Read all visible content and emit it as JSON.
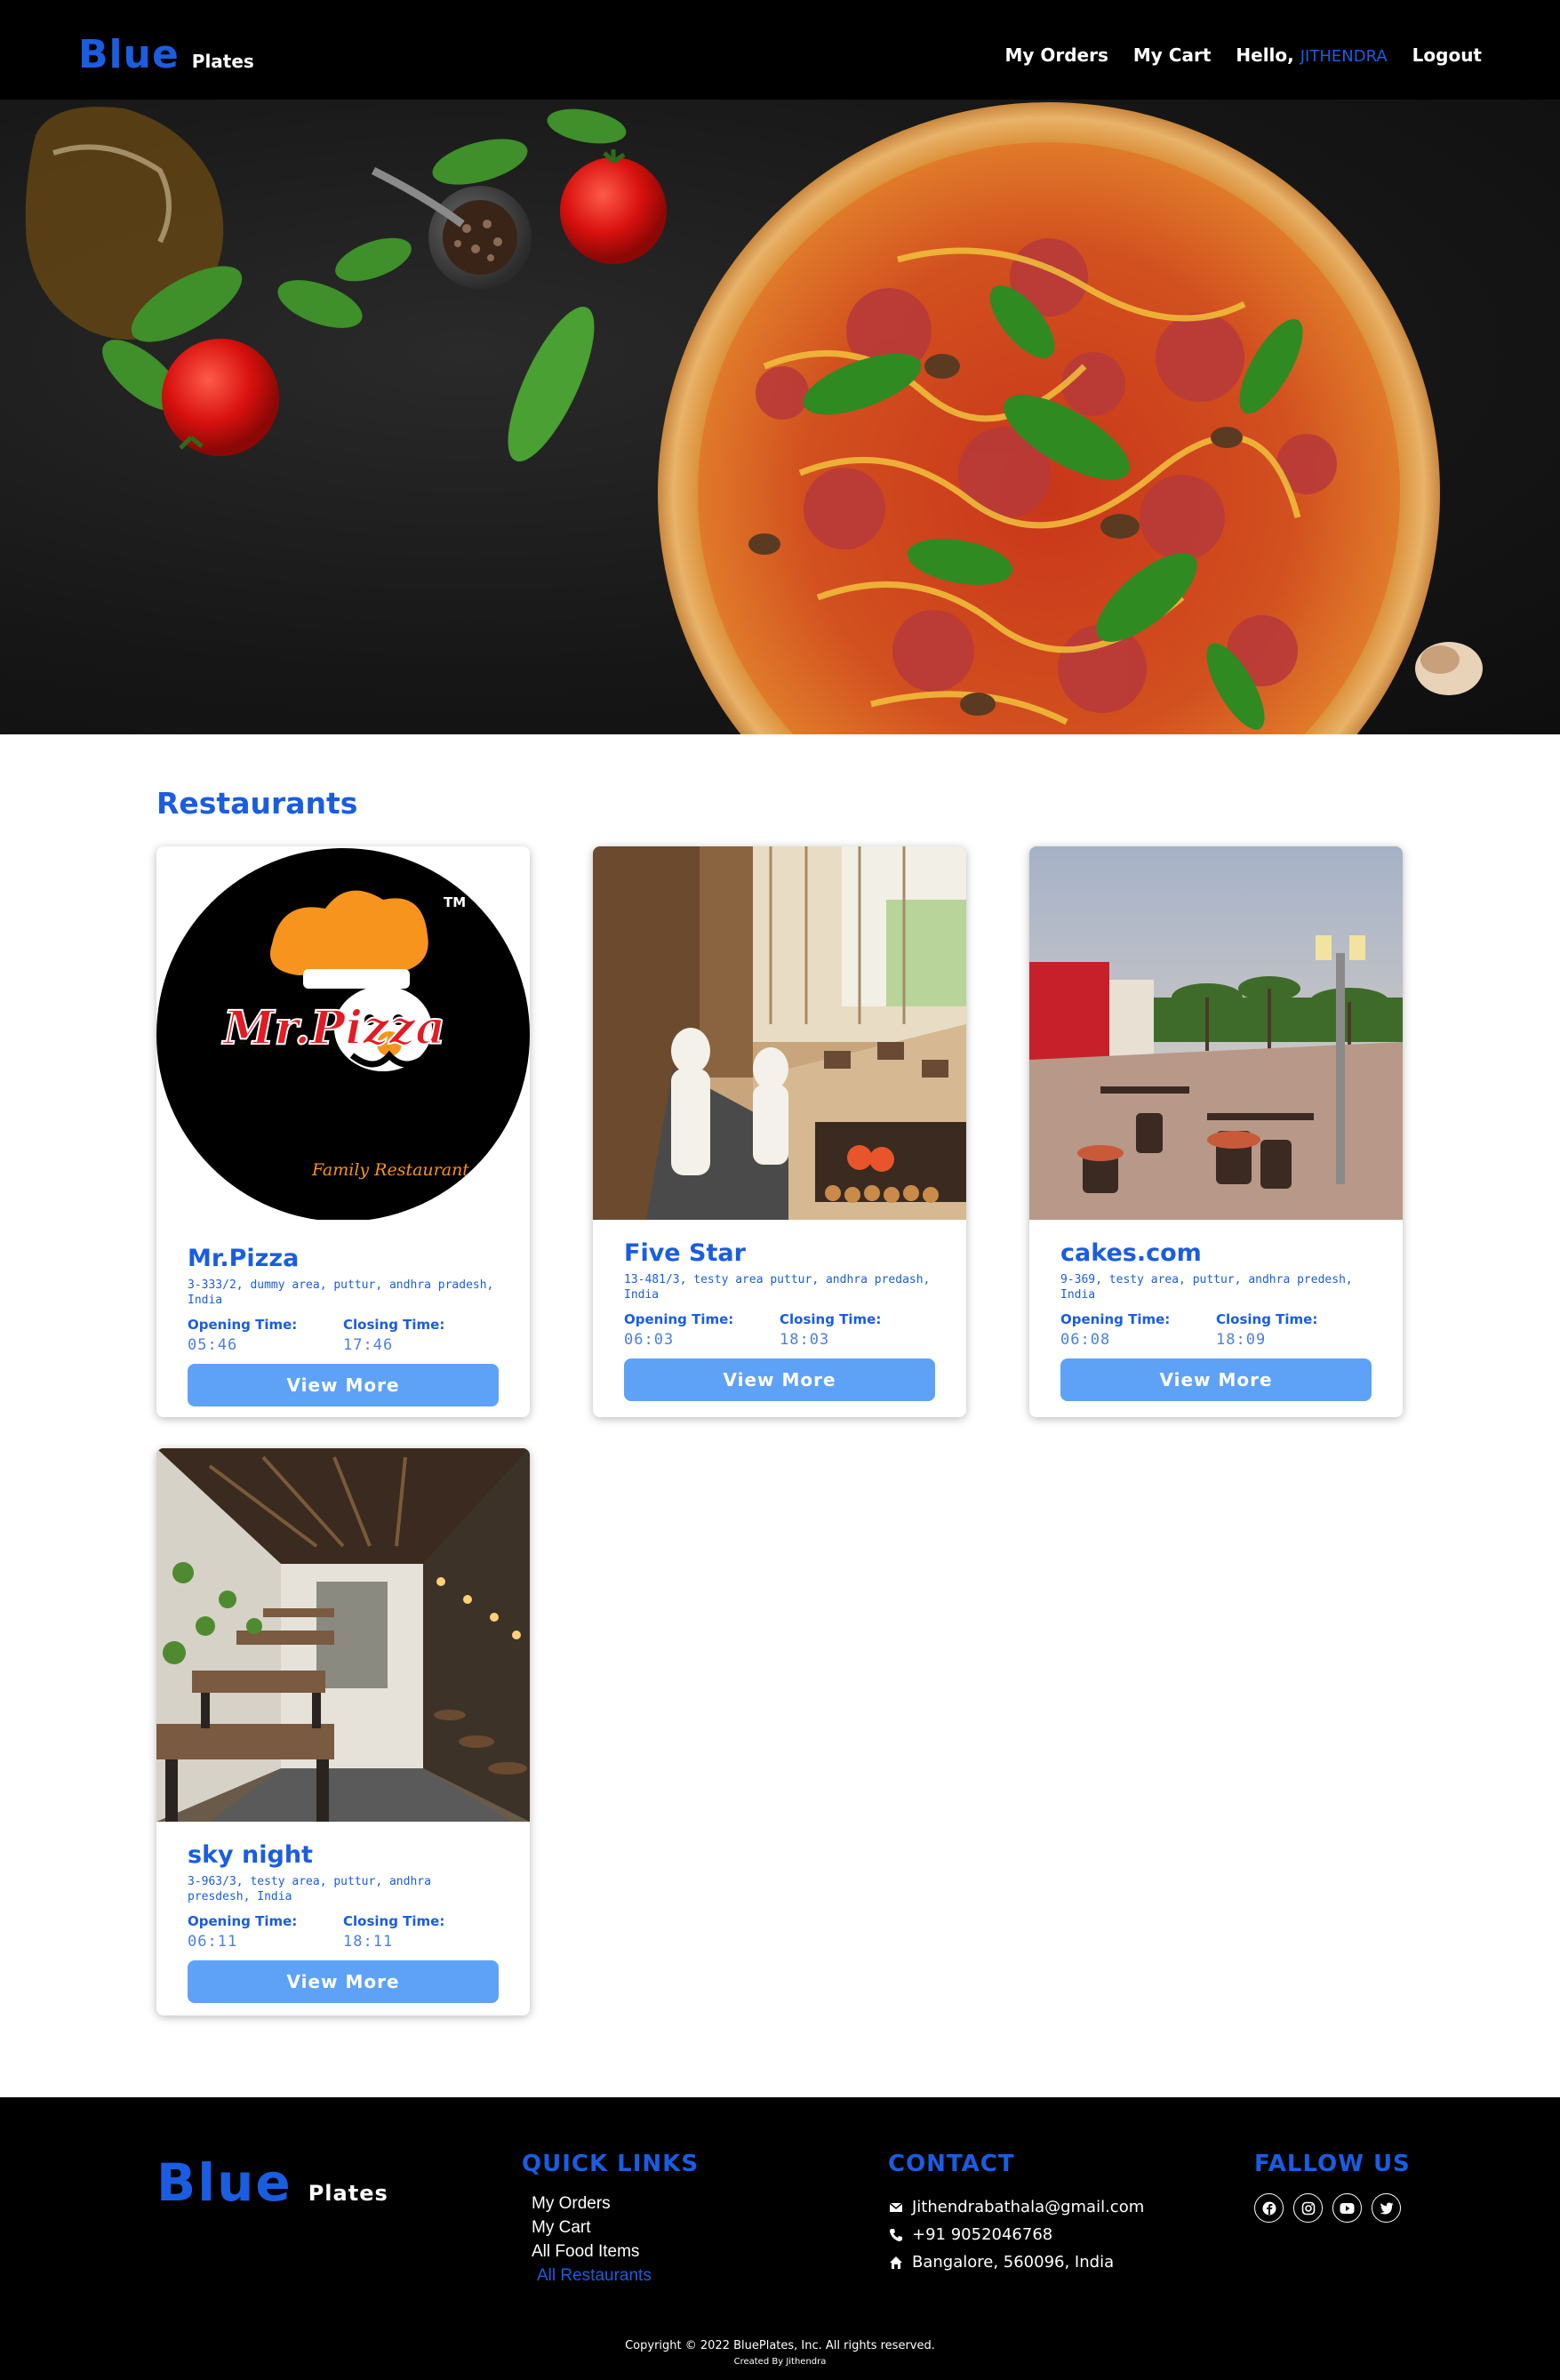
{
  "navbar": {
    "brand_main": "Blue",
    "brand_sub": "Plates",
    "links": {
      "orders": "My Orders",
      "cart": "My Cart",
      "hello": "Hello,",
      "user": "JITHENDRA",
      "logout": "Logout"
    }
  },
  "colors": {
    "brand_blue": "#1a5de0",
    "button_blue": "#5ea2f7",
    "nav_bg": "#000000"
  },
  "restaurants": {
    "title": "Restaurants",
    "opening_label": "Opening Time:",
    "closing_label": "Closing Time:",
    "button_label": "View More",
    "items": [
      {
        "name": "Mr.Pizza",
        "address": "3-333/2, dummy area, puttur, andhra pradesh, India",
        "opening": "05:46",
        "closing": "17:46",
        "logo_text": "Mr.Pizza",
        "logo_sub": "Family Restaurant",
        "logo_tm": "TM"
      },
      {
        "name": "Five Star",
        "address": "13-481/3, testy area puttur, andhra predash, India",
        "opening": "06:03",
        "closing": "18:03"
      },
      {
        "name": "cakes.com",
        "address": "9-369, testy area, puttur, andhra predesh, India",
        "opening": "06:08",
        "closing": "18:09"
      },
      {
        "name": "sky night",
        "address": "3-963/3, testy area, puttur, andhra presdesh, India",
        "opening": "06:11",
        "closing": "18:11"
      }
    ]
  },
  "footer": {
    "brand_main": "Blue",
    "brand_sub": "Plates",
    "quick_links_title": "QUICK LINKS",
    "quick_links": [
      "My Orders",
      "My Cart",
      "All Food Items",
      "All Restaurants"
    ],
    "contact_title": "CONTACT",
    "contact": {
      "email": "Jithendrabathala@gmail.com",
      "phone": "+91 9052046768",
      "address": "Bangalore, 560096, India"
    },
    "follow_title": "FALLOW US",
    "socials": [
      "facebook-icon",
      "instagram-icon",
      "youtube-icon",
      "twitter-icon"
    ],
    "copyright": "Copyright © 2022 BluePlates, Inc. All rights reserved.",
    "created_by": "Created By Jithendra"
  }
}
